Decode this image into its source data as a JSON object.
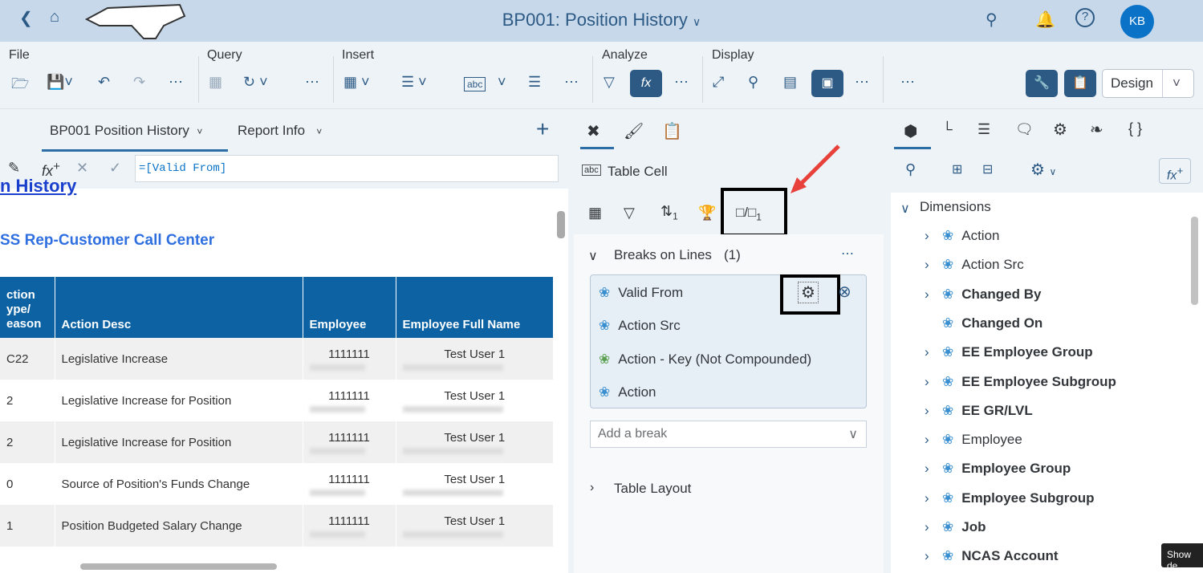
{
  "shell": {
    "title": "BP001: Position History",
    "avatar": "KB"
  },
  "toolbar": {
    "groups": [
      "File",
      "Query",
      "Insert",
      "Analyze",
      "Display"
    ],
    "design": "Design"
  },
  "report_tabs": [
    {
      "label": "BP001 Position History"
    },
    {
      "label": "Report Info"
    }
  ],
  "formula": "=[Valid From]",
  "report": {
    "title_partial": "n History",
    "subtitle": "SS Rep-Customer Call Center",
    "columns": [
      "ction\nype/\neason",
      "Action Desc",
      "Employee",
      "Employee Full Name"
    ],
    "rows": [
      [
        "C22",
        "Legislative Increase",
        "1111111",
        "Test User 1"
      ],
      [
        "2",
        "Legislative Increase for Position",
        "1111111",
        "Test User 1"
      ],
      [
        "2",
        "Legislative Increase for Position",
        "1111111",
        "Test User 1"
      ],
      [
        "0",
        "Source of Position's Funds Change",
        "1111111",
        "Test User 1"
      ],
      [
        "1",
        "Position Budgeted Salary Change",
        "1111111",
        "Test User 1"
      ]
    ]
  },
  "mid": {
    "context": "Table Cell",
    "sort_count": "1",
    "break_count": "1",
    "breaks_header": "Breaks on Lines",
    "breaks_count_label": "(1)",
    "breaks": [
      "Valid From",
      "Action Src",
      "Action - Key (Not Compounded)",
      "Action"
    ],
    "add_break_placeholder": "Add a break",
    "table_layout": "Table Layout"
  },
  "right": {
    "section": "Dimensions",
    "dims": [
      {
        "label": "Action",
        "bold": false,
        "exp": true
      },
      {
        "label": "Action Src",
        "bold": false,
        "exp": true
      },
      {
        "label": "Changed By",
        "bold": true,
        "exp": true
      },
      {
        "label": "Changed On",
        "bold": true,
        "exp": false
      },
      {
        "label": "EE Employee Group",
        "bold": true,
        "exp": true
      },
      {
        "label": "EE Employee Subgroup",
        "bold": true,
        "exp": true
      },
      {
        "label": "EE GR/LVL",
        "bold": true,
        "exp": true
      },
      {
        "label": "Employee",
        "bold": false,
        "exp": true
      },
      {
        "label": "Employee Group",
        "bold": true,
        "exp": true
      },
      {
        "label": "Employee Subgroup",
        "bold": true,
        "exp": true
      },
      {
        "label": "Job",
        "bold": true,
        "exp": true
      },
      {
        "label": "NCAS Account",
        "bold": true,
        "exp": true
      }
    ]
  },
  "tooltip": "Show de"
}
